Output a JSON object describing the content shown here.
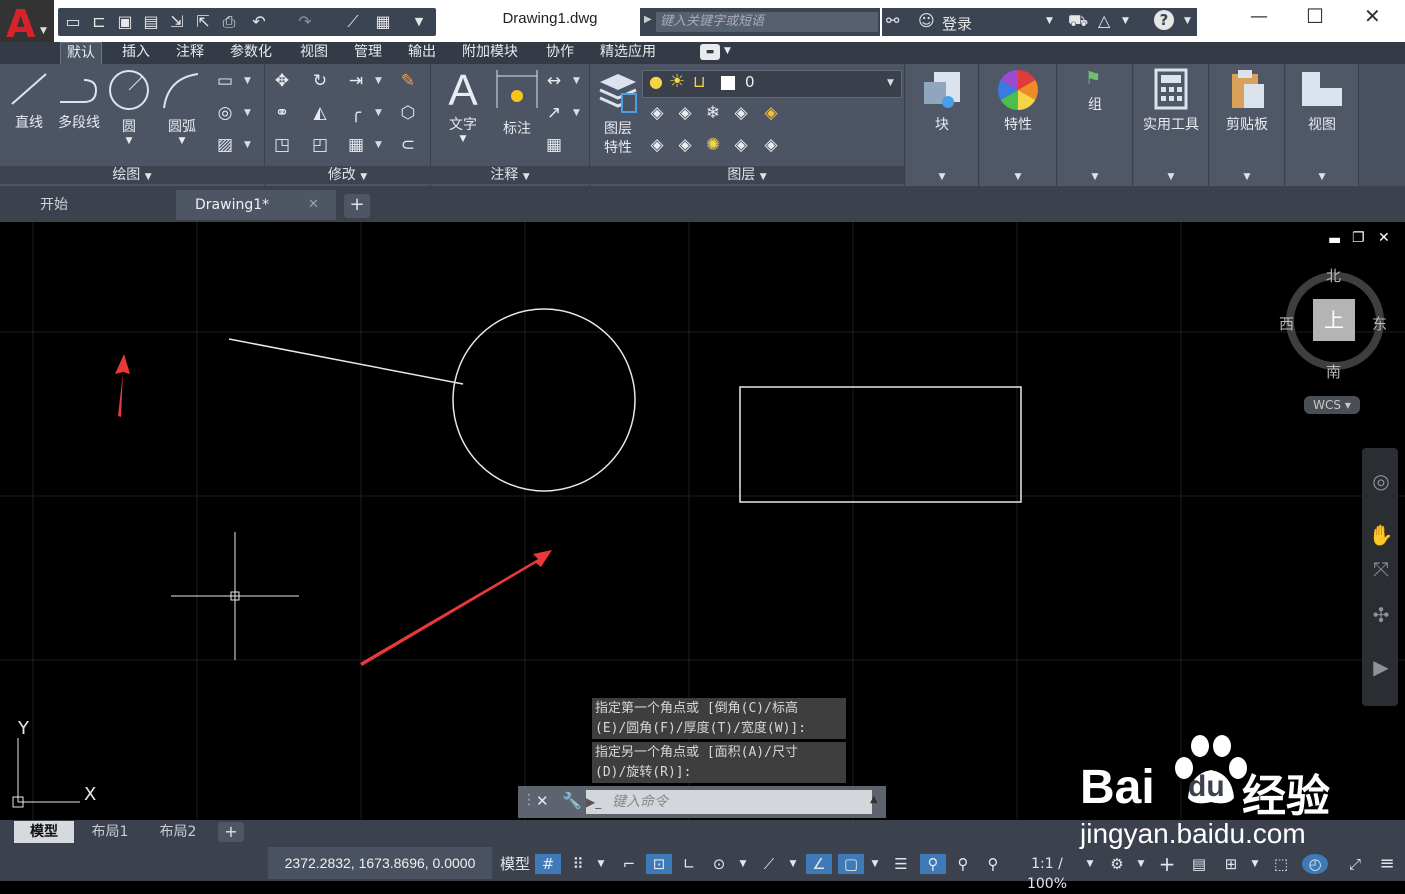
{
  "titlebar": {
    "doc_title": "Drawing1.dwg",
    "search_placeholder": "键入关键字或短语",
    "login": "登录"
  },
  "ribbon_tabs": [
    "默认",
    "插入",
    "注释",
    "参数化",
    "视图",
    "管理",
    "输出",
    "附加模块",
    "协作",
    "精选应用"
  ],
  "panels": {
    "draw": {
      "title": "绘图",
      "line": "直线",
      "polyline": "多段线",
      "circle": "圆",
      "arc": "圆弧"
    },
    "modify": {
      "title": "修改"
    },
    "annotation": {
      "title": "注释",
      "text": "文字",
      "dimension": "标注"
    },
    "layers": {
      "title": "图层",
      "layer_props": "图层\n特性",
      "layer_props_l1": "图层",
      "layer_props_l2": "特性",
      "current_layer": "0"
    },
    "block": {
      "label": "块"
    },
    "properties": {
      "label": "特性"
    },
    "groups": {
      "label": "组"
    },
    "utilities": {
      "label": "实用工具"
    },
    "clipboard": {
      "label": "剪贴板"
    },
    "view": {
      "label": "视图"
    }
  },
  "file_tabs": [
    {
      "label": "开始"
    },
    {
      "label": "Drawing1*"
    }
  ],
  "viewcube": {
    "north": "北",
    "south": "南",
    "east": "东",
    "west": "西",
    "face": "上",
    "wcs": "WCS"
  },
  "ucs": {
    "x": "X",
    "y": "Y"
  },
  "command": {
    "history_1a": "指定第一个角点或 [倒角(C)/标高",
    "history_1b": "(E)/圆角(F)/厚度(T)/宽度(W)]:",
    "history_2a": "指定另一个角点或 [面积(A)/尺寸",
    "history_2b": "(D)/旋转(R)]:",
    "input_placeholder": "键入命令"
  },
  "layout_tabs": [
    "模型",
    "布局1",
    "布局2"
  ],
  "status": {
    "coords": "2372.2832, 1673.8696, 0.0000",
    "model": "模型",
    "scale": "1:1 / 100%"
  },
  "watermark": {
    "brand": "Bai",
    "brand2": "du",
    "cn": "经验",
    "url": "jingyan.baidu.com"
  },
  "colors": {
    "accent_red": "#d8222a",
    "arrow_red": "#e8393a",
    "ribbon_bg": "#4a5160",
    "status_on": "#3e7ab8"
  }
}
